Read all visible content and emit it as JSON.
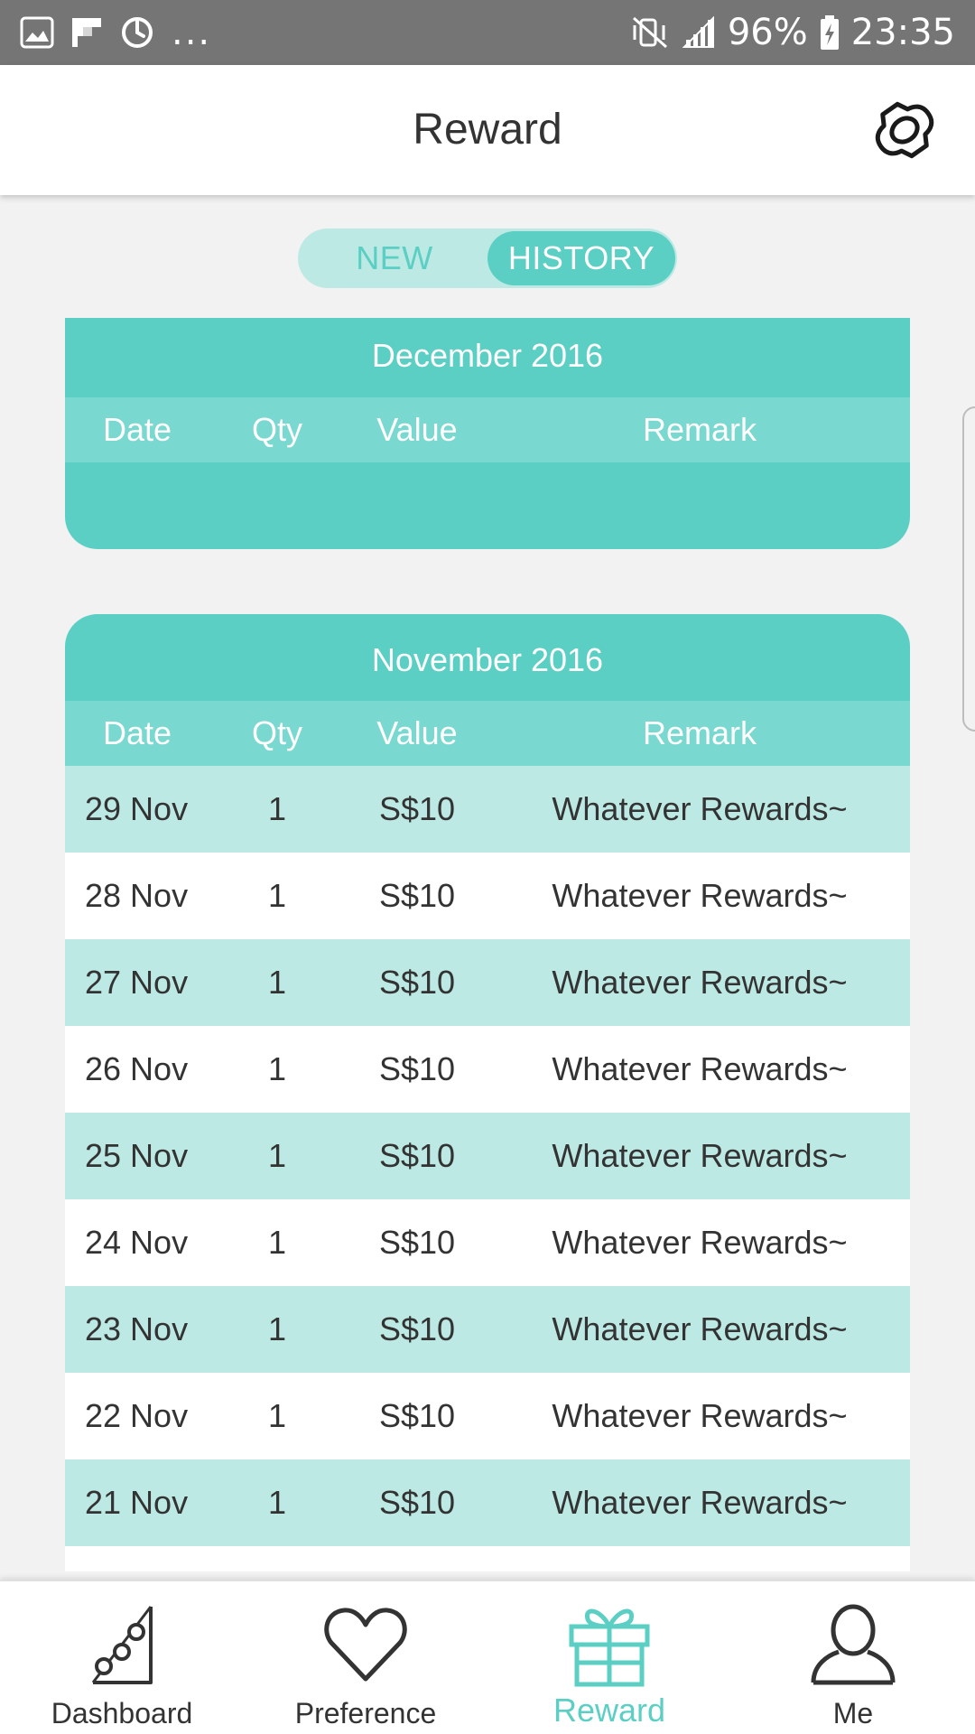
{
  "status_bar": {
    "battery": "96%",
    "time": "23:35",
    "more": "..."
  },
  "header": {
    "title": "Reward"
  },
  "segment": {
    "new_label": "NEW",
    "history_label": "HISTORY",
    "selected": "HISTORY"
  },
  "columns": {
    "date": "Date",
    "qty": "Qty",
    "value": "Value",
    "remark": "Remark"
  },
  "months": [
    {
      "title": "December 2016",
      "rows": []
    },
    {
      "title": "November 2016",
      "rows": [
        {
          "date": "29 Nov",
          "qty": "1",
          "value": "S$10",
          "remark": "Whatever Rewards~"
        },
        {
          "date": "28 Nov",
          "qty": "1",
          "value": "S$10",
          "remark": "Whatever Rewards~"
        },
        {
          "date": "27 Nov",
          "qty": "1",
          "value": "S$10",
          "remark": "Whatever Rewards~"
        },
        {
          "date": "26 Nov",
          "qty": "1",
          "value": "S$10",
          "remark": "Whatever Rewards~"
        },
        {
          "date": "25 Nov",
          "qty": "1",
          "value": "S$10",
          "remark": "Whatever Rewards~"
        },
        {
          "date": "24 Nov",
          "qty": "1",
          "value": "S$10",
          "remark": "Whatever Rewards~"
        },
        {
          "date": "23 Nov",
          "qty": "1",
          "value": "S$10",
          "remark": "Whatever Rewards~"
        },
        {
          "date": "22 Nov",
          "qty": "1",
          "value": "S$10",
          "remark": "Whatever Rewards~"
        },
        {
          "date": "21 Nov",
          "qty": "1",
          "value": "S$10",
          "remark": "Whatever Rewards~"
        }
      ]
    }
  ],
  "bottom_nav": {
    "items": [
      {
        "label": "Dashboard",
        "icon": "dashboard-chart-icon"
      },
      {
        "label": "Preference",
        "icon": "heart-icon"
      },
      {
        "label": "Reward",
        "icon": "gift-icon",
        "active": true
      },
      {
        "label": "Me",
        "icon": "person-icon"
      }
    ]
  },
  "colors": {
    "accent": "#5bcfc4",
    "header_row": "#79d8d0",
    "row_alt": "#bde9e5",
    "status_bar": "#757575"
  }
}
